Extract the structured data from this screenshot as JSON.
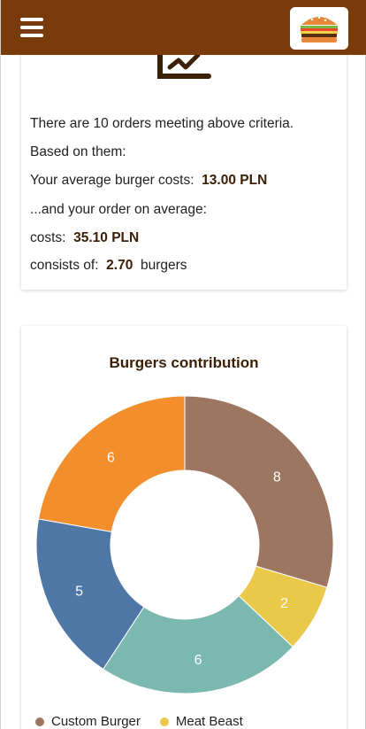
{
  "header": {
    "menu_icon": "hamburger-menu-icon",
    "logo_icon": "burger-logo-icon",
    "background_color": "#7a3b0c"
  },
  "stats": {
    "icon": "chart-trend-icon",
    "line1": "There are 10 orders meeting above criteria.",
    "line2": "Based on them:",
    "avg_burger_label": "Your average burger costs:",
    "avg_burger_value": "13.00 PLN",
    "order_avg_label": "...and your order on average:",
    "costs_label": "costs:",
    "costs_value": "35.10 PLN",
    "consists_label": "consists of:",
    "consists_value": "2.70",
    "consists_unit": "burgers"
  },
  "chart_data": {
    "type": "pie",
    "title": "Burgers contribution",
    "donut": true,
    "categories": [
      "Custom Burger",
      "Meat Beast",
      "",
      "",
      ""
    ],
    "values": [
      8,
      2,
      6,
      5,
      6
    ],
    "colors": [
      "#9c7660",
      "#eac84a",
      "#7ab8b0",
      "#4f77a6",
      "#f28e2c"
    ],
    "legend_position": "bottom",
    "visible_legend_entries": [
      "Custom Burger",
      "Meat Beast"
    ]
  }
}
